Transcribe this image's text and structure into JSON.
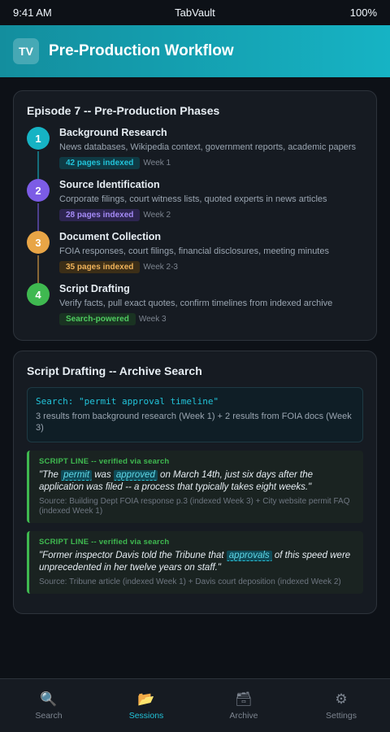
{
  "status_bar": {
    "time": "9:41 AM",
    "title": "TabVault",
    "battery": "100%"
  },
  "header": {
    "logo_text": "TV",
    "title": "Pre-Production Workflow"
  },
  "phases_card": {
    "title": "Episode 7 -- Pre-Production Phases",
    "phases": [
      {
        "num": "1",
        "title": "Background Research",
        "desc": "News databases, Wikipedia context, government reports, academic papers",
        "badge": "42 pages indexed",
        "week": "Week 1",
        "color": "#16b3c4",
        "badge_bg": "#0f3a44",
        "badge_fg": "#22c3d9"
      },
      {
        "num": "2",
        "title": "Source Identification",
        "desc": "Corporate filings, court witness lists, quoted experts in news articles",
        "badge": "28 pages indexed",
        "week": "Week 2",
        "color": "#7c5ce6",
        "badge_bg": "#2d2550",
        "badge_fg": "#a58bf7"
      },
      {
        "num": "3",
        "title": "Document Collection",
        "desc": "FOIA responses, court filings, financial disclosures, meeting minutes",
        "badge": "35 pages indexed",
        "week": "Week 2-3",
        "color": "#e8a546",
        "badge_bg": "#3c2e17",
        "badge_fg": "#f0b35a"
      },
      {
        "num": "4",
        "title": "Script Drafting",
        "desc": "Verify facts, pull exact quotes, confirm timelines from indexed archive",
        "badge": "Search-powered",
        "week": "Week 3",
        "color": "#3fb950",
        "badge_bg": "#1a3322",
        "badge_fg": "#4fcc60"
      }
    ]
  },
  "search_card": {
    "title": "Script Drafting -- Archive Search",
    "query": "Search: \"permit approval timeline\"",
    "results": "3 results from background research (Week 1) + 2 results from FOIA docs (Week 3)",
    "lines": [
      {
        "label": "SCRIPT LINE -- verified via search",
        "q1": "\"The ",
        "h1": "permit",
        "q2": " was ",
        "h2": "approved",
        "q3": " on March 14th, just six days after the application was filed -- a process that typically takes eight weeks.\"",
        "source": "Source: Building Dept FOIA response p.3 (indexed Week 3) + City website permit FAQ (indexed Week 1)"
      },
      {
        "label": "SCRIPT LINE -- verified via search",
        "q1": "\"Former inspector Davis told the Tribune that ",
        "h1": "approvals",
        "q2": " of this speed were unprecedented in her twelve years on staff.\"",
        "source": "Source: Tribune article (indexed Week 1) + Davis court deposition (indexed Week 2)"
      }
    ]
  },
  "nav": [
    {
      "label": "Search",
      "icon": "🔍",
      "icon_name": "search-icon"
    },
    {
      "label": "Sessions",
      "icon": "📂",
      "icon_name": "folder-icon"
    },
    {
      "label": "Archive",
      "icon": "🗃",
      "icon_name": "archive-box-icon"
    },
    {
      "label": "Settings",
      "icon": "⚙",
      "icon_name": "gear-icon"
    }
  ],
  "nav_active": "Sessions"
}
